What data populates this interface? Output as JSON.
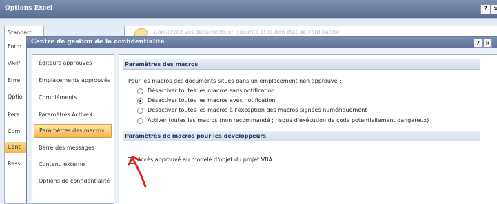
{
  "outer": {
    "title": "Options Excel",
    "help": "?",
    "close": "×",
    "nav": [
      "Standard",
      "Form",
      "Vérif",
      "Enre",
      "Optio",
      "Pers",
      "Com",
      "Cent",
      "Ress"
    ],
    "selected_index": 7,
    "content_text": "Conservez vos documents en sécurité et le bon état de l'ordinateur"
  },
  "inner": {
    "title": "Centre de gestion de la confidentialité",
    "help": "?",
    "close": "×",
    "nav": [
      "Éditeurs approuvés",
      "Emplacements approuvés",
      "Compléments",
      "Paramètres ActiveX",
      "Paramètres des macros",
      "Barre des messages",
      "Contenu externe",
      "Options de confidentialité"
    ],
    "selected_index": 4
  },
  "macros": {
    "header": "Paramètres des macros",
    "intro": "Pour les macros des documents situés dans un emplacement non approuvé :",
    "options": [
      "Désactiver toutes les macros sans notification",
      "Désactiver toutes les macros avec notification",
      "Désactiver toutes les macros à l'exception des macros signées numériquement",
      "Activer toutes les macros (non recommandé ; risque d'exécution de code potentiellement dangereux)"
    ],
    "selected": 1
  },
  "dev": {
    "header": "Paramètres de macros pour les développeurs",
    "checkbox_label": "Accès approuvé au modèle d'objet du projet VBA",
    "checked": true,
    "check_mark": "✔"
  },
  "colors": {
    "annotation_arrow": "#e0271f",
    "selection": "#f7b54e",
    "titlebar": "#6a7da3"
  }
}
